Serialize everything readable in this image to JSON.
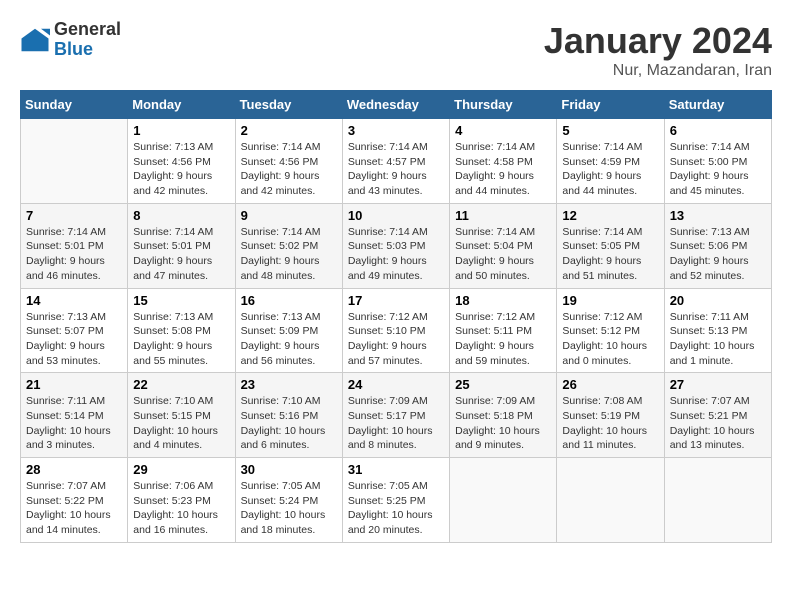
{
  "logo": {
    "general": "General",
    "blue": "Blue"
  },
  "header": {
    "month": "January 2024",
    "location": "Nur, Mazandaran, Iran"
  },
  "days_of_week": [
    "Sunday",
    "Monday",
    "Tuesday",
    "Wednesday",
    "Thursday",
    "Friday",
    "Saturday"
  ],
  "weeks": [
    [
      {
        "day": "",
        "sunrise": "",
        "sunset": "",
        "daylight": ""
      },
      {
        "day": "1",
        "sunrise": "7:13 AM",
        "sunset": "4:56 PM",
        "daylight": "9 hours and 42 minutes."
      },
      {
        "day": "2",
        "sunrise": "7:14 AM",
        "sunset": "4:56 PM",
        "daylight": "9 hours and 42 minutes."
      },
      {
        "day": "3",
        "sunrise": "7:14 AM",
        "sunset": "4:57 PM",
        "daylight": "9 hours and 43 minutes."
      },
      {
        "day": "4",
        "sunrise": "7:14 AM",
        "sunset": "4:58 PM",
        "daylight": "9 hours and 44 minutes."
      },
      {
        "day": "5",
        "sunrise": "7:14 AM",
        "sunset": "4:59 PM",
        "daylight": "9 hours and 44 minutes."
      },
      {
        "day": "6",
        "sunrise": "7:14 AM",
        "sunset": "5:00 PM",
        "daylight": "9 hours and 45 minutes."
      }
    ],
    [
      {
        "day": "7",
        "sunrise": "7:14 AM",
        "sunset": "5:01 PM",
        "daylight": "9 hours and 46 minutes."
      },
      {
        "day": "8",
        "sunrise": "7:14 AM",
        "sunset": "5:01 PM",
        "daylight": "9 hours and 47 minutes."
      },
      {
        "day": "9",
        "sunrise": "7:14 AM",
        "sunset": "5:02 PM",
        "daylight": "9 hours and 48 minutes."
      },
      {
        "day": "10",
        "sunrise": "7:14 AM",
        "sunset": "5:03 PM",
        "daylight": "9 hours and 49 minutes."
      },
      {
        "day": "11",
        "sunrise": "7:14 AM",
        "sunset": "5:04 PM",
        "daylight": "9 hours and 50 minutes."
      },
      {
        "day": "12",
        "sunrise": "7:14 AM",
        "sunset": "5:05 PM",
        "daylight": "9 hours and 51 minutes."
      },
      {
        "day": "13",
        "sunrise": "7:13 AM",
        "sunset": "5:06 PM",
        "daylight": "9 hours and 52 minutes."
      }
    ],
    [
      {
        "day": "14",
        "sunrise": "7:13 AM",
        "sunset": "5:07 PM",
        "daylight": "9 hours and 53 minutes."
      },
      {
        "day": "15",
        "sunrise": "7:13 AM",
        "sunset": "5:08 PM",
        "daylight": "9 hours and 55 minutes."
      },
      {
        "day": "16",
        "sunrise": "7:13 AM",
        "sunset": "5:09 PM",
        "daylight": "9 hours and 56 minutes."
      },
      {
        "day": "17",
        "sunrise": "7:12 AM",
        "sunset": "5:10 PM",
        "daylight": "9 hours and 57 minutes."
      },
      {
        "day": "18",
        "sunrise": "7:12 AM",
        "sunset": "5:11 PM",
        "daylight": "9 hours and 59 minutes."
      },
      {
        "day": "19",
        "sunrise": "7:12 AM",
        "sunset": "5:12 PM",
        "daylight": "10 hours and 0 minutes."
      },
      {
        "day": "20",
        "sunrise": "7:11 AM",
        "sunset": "5:13 PM",
        "daylight": "10 hours and 1 minute."
      }
    ],
    [
      {
        "day": "21",
        "sunrise": "7:11 AM",
        "sunset": "5:14 PM",
        "daylight": "10 hours and 3 minutes."
      },
      {
        "day": "22",
        "sunrise": "7:10 AM",
        "sunset": "5:15 PM",
        "daylight": "10 hours and 4 minutes."
      },
      {
        "day": "23",
        "sunrise": "7:10 AM",
        "sunset": "5:16 PM",
        "daylight": "10 hours and 6 minutes."
      },
      {
        "day": "24",
        "sunrise": "7:09 AM",
        "sunset": "5:17 PM",
        "daylight": "10 hours and 8 minutes."
      },
      {
        "day": "25",
        "sunrise": "7:09 AM",
        "sunset": "5:18 PM",
        "daylight": "10 hours and 9 minutes."
      },
      {
        "day": "26",
        "sunrise": "7:08 AM",
        "sunset": "5:19 PM",
        "daylight": "10 hours and 11 minutes."
      },
      {
        "day": "27",
        "sunrise": "7:07 AM",
        "sunset": "5:21 PM",
        "daylight": "10 hours and 13 minutes."
      }
    ],
    [
      {
        "day": "28",
        "sunrise": "7:07 AM",
        "sunset": "5:22 PM",
        "daylight": "10 hours and 14 minutes."
      },
      {
        "day": "29",
        "sunrise": "7:06 AM",
        "sunset": "5:23 PM",
        "daylight": "10 hours and 16 minutes."
      },
      {
        "day": "30",
        "sunrise": "7:05 AM",
        "sunset": "5:24 PM",
        "daylight": "10 hours and 18 minutes."
      },
      {
        "day": "31",
        "sunrise": "7:05 AM",
        "sunset": "5:25 PM",
        "daylight": "10 hours and 20 minutes."
      },
      {
        "day": "",
        "sunrise": "",
        "sunset": "",
        "daylight": ""
      },
      {
        "day": "",
        "sunrise": "",
        "sunset": "",
        "daylight": ""
      },
      {
        "day": "",
        "sunrise": "",
        "sunset": "",
        "daylight": ""
      }
    ]
  ],
  "labels": {
    "sunrise": "Sunrise:",
    "sunset": "Sunset:",
    "daylight": "Daylight:"
  }
}
